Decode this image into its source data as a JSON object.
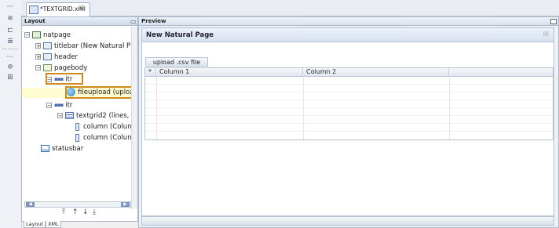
{
  "editor": {
    "tab_label": "*TEXTGRID.xml",
    "tab_close_glyph": "☒"
  },
  "left_toolbar": {
    "icons": [
      "dots-handle-icon",
      "hierarchy-icon",
      "collapse-icon",
      "list-icon",
      "dots-handle-icon",
      "hierarchy-icon",
      "component-icon"
    ]
  },
  "layout_panel": {
    "title": "Layout",
    "tree": {
      "natpage": "natpage",
      "titlebar": "titlebar (New Natural P",
      "header": "header",
      "pagebody": "pagebody",
      "itr1": "itr",
      "fileupload": "fileupload (uploa",
      "itr2": "itr",
      "textgrid2": "textgrid2 (lines,",
      "column1": "column (Colun",
      "column2": "column (Colun",
      "statusbar": "statusbar"
    },
    "nav": {
      "top": "⤒",
      "up": "↑",
      "down": "↓",
      "bottom": "⤓"
    },
    "bottom_tabs": [
      "Layout",
      "XML"
    ]
  },
  "preview_panel": {
    "title": "Preview",
    "page_title": "New Natural Page",
    "close_glyph": "☒",
    "upload_button": "upload .csv file",
    "grid": {
      "marker": "*",
      "columns": [
        "Column 1",
        "Column 2"
      ]
    }
  },
  "colors": {
    "highlight_border": "#d08a1a",
    "selection_bg": "#fffccf",
    "accent": "#4a78b5"
  }
}
